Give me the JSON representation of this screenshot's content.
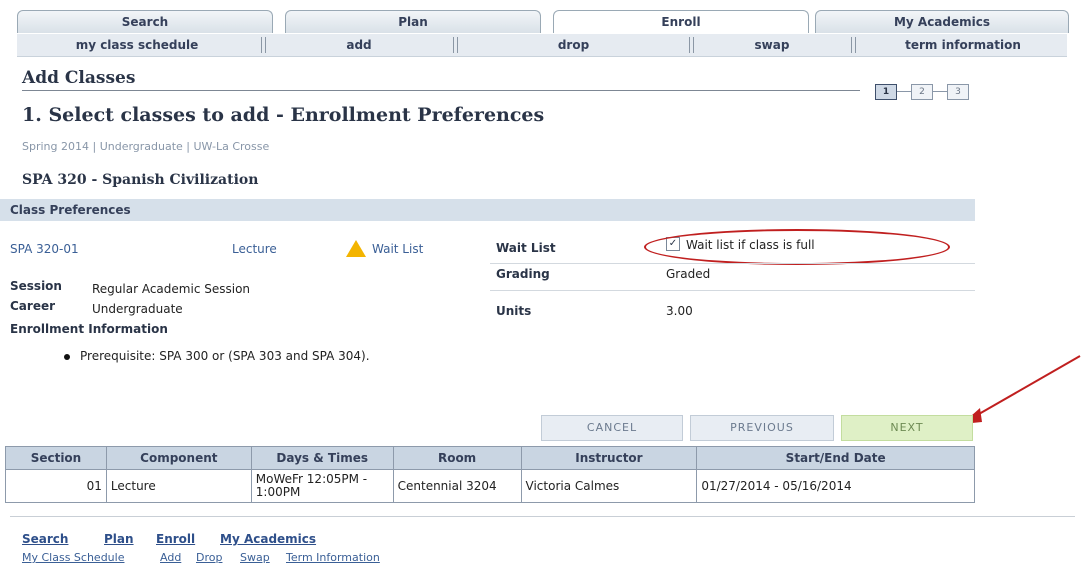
{
  "tabs": [
    "Search",
    "Plan",
    "Enroll",
    "My Academics"
  ],
  "subnav": [
    "my class schedule",
    "add",
    "drop",
    "swap",
    "term information"
  ],
  "page": {
    "heading": "Add Classes",
    "title": "1. Select classes to add - Enrollment Preferences",
    "term": "Spring 2014 | Undergraduate | UW-La Crosse",
    "course": "SPA 320 - Spanish Civilization",
    "steps": [
      "1",
      "2",
      "3"
    ]
  },
  "prefs": {
    "section_title": "Class Preferences",
    "class_section": "SPA 320-01",
    "component": "Lecture",
    "status": "Wait List",
    "session_label": "Session",
    "session_value": "Regular Academic Session",
    "career_label": "Career",
    "career_value": "Undergraduate",
    "enroll_info_label": "Enrollment Information",
    "prereq": "Prerequisite: SPA 300 or (SPA 303 and SPA 304).",
    "waitlist_label": "Wait List",
    "waitlist_text": "Wait list if class is full",
    "waitlist_checked": true,
    "grading_label": "Grading",
    "grading_value": "Graded",
    "units_label": "Units",
    "units_value": "3.00"
  },
  "buttons": {
    "cancel": "CANCEL",
    "previous": "PREVIOUS",
    "next": "NEXT"
  },
  "table": {
    "headers": [
      "Section",
      "Component",
      "Days & Times",
      "Room",
      "Instructor",
      "Start/End Date"
    ],
    "rows": [
      [
        "01",
        "Lecture",
        "MoWeFr 12:05PM - 1:00PM",
        "Centennial 3204",
        "Victoria Calmes",
        "01/27/2014 - 05/16/2014"
      ]
    ]
  },
  "footer": {
    "primary": [
      "Search",
      "Plan",
      "Enroll",
      "My Academics"
    ],
    "secondary": [
      "My Class Schedule",
      "Add",
      "Drop",
      "Swap",
      "Term Information"
    ]
  },
  "colors": {
    "annotation": "#c01f1f",
    "next_button": "#dff0c6",
    "warning": "#f3b400"
  }
}
